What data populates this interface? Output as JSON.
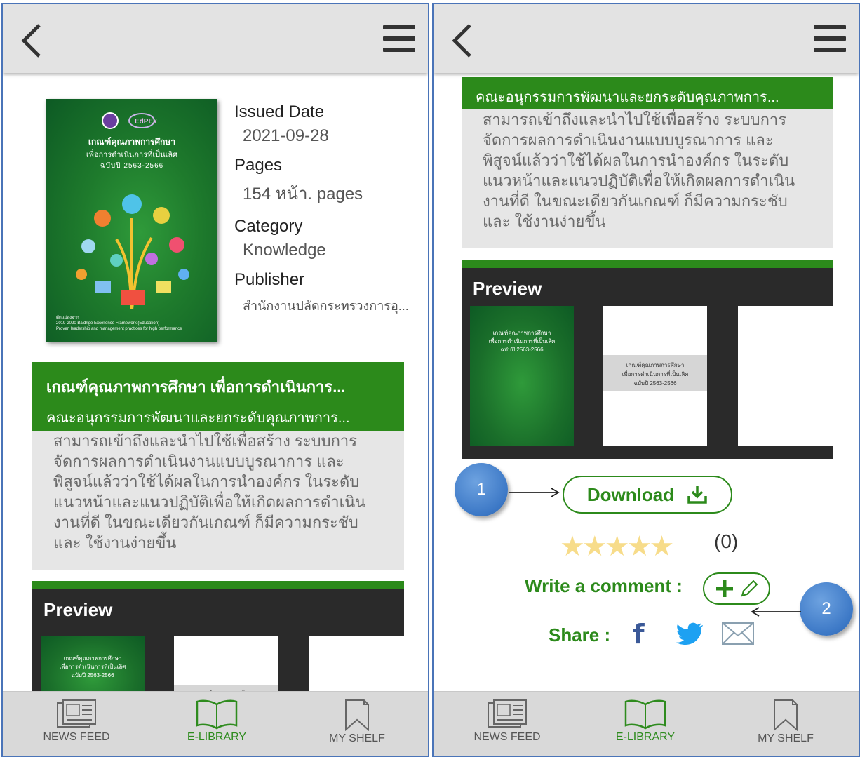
{
  "left": {
    "meta": [
      {
        "label": "Issued Date",
        "value": "2021-09-28"
      },
      {
        "label": "Pages",
        "value": "154 หน้า. pages"
      },
      {
        "label": "Category",
        "value": "Knowledge"
      },
      {
        "label": "Publisher",
        "value": "สำนักงานปลัดกระทรวงการอุ..."
      }
    ],
    "cover": {
      "title": "เกณฑ์คุณภาพการศึกษา",
      "subtitle": "เพื่อการดำเนินการที่เป็นเลิศ",
      "edition": "ฉบับปี 2563-2566",
      "footer1": "ดัดแปลงจาก",
      "footer2": "2019-2020 Baldrige Excellence Framework (Education)",
      "footer3": "Proven leadership and management practices for high performance"
    },
    "book_title": "เกณฑ์คุณภาพการศึกษา เพื่อการดำเนินการ...",
    "book_author": "คณะอนุกรรมการพัฒนาและยกระดับคุณภาพการ...",
    "description": "สามารถเข้าถึงและนำไปใช้เพื่อสร้าง ระบบการจัดการผลการดำเนินงานแบบบูรณาการ และพิสูจน์แล้วว่าใช้ได้ผลในการนำองค์กร ในระดับแนวหน้าและแนวปฏิบัติเพื่อให้เกิดผลการดำเนินงานที่ดี ในขณะเดียวกันเกณฑ์ ก็มีความกระชับและ ใช้งานง่ายขึ้น",
    "preview_title": "Preview"
  },
  "right": {
    "book_author": "คณะอนุกรรมการพัฒนาและยกระดับคุณภาพการ...",
    "description": "สามารถเข้าถึงและนำไปใช้เพื่อสร้าง ระบบการจัดการผลการดำเนินงานแบบบูรณาการ และพิสูจน์แล้วว่าใช้ได้ผลในการนำองค์กร ในระดับแนวหน้าและแนวปฏิบัติเพื่อให้เกิดผลการดำเนินงานที่ดี ในขณะเดียวกันเกณฑ์ ก็มีความกระชับและ ใช้งานง่ายขึ้น",
    "preview_title": "Preview",
    "download_label": "Download",
    "rating_stars": 5,
    "rating_count": "(0)",
    "comment_label": "Write a comment :",
    "share_label": "Share :"
  },
  "preview_page": {
    "title": "เกณฑ์คุณภาพการศึกษา",
    "subtitle": "เพื่อการดำเนินการที่เป็นเลิศ",
    "edition": "ฉบับปี 2563-2566"
  },
  "nav": {
    "news_feed": "NEWS FEED",
    "e_library": "E-LIBRARY",
    "my_shelf": "MY SHELF"
  },
  "callouts": {
    "one": "1",
    "two": "2"
  },
  "colors": {
    "accent_green": "#2c8a1b",
    "callout_blue": "#3c78c6",
    "border_blue": "#4a74b8"
  }
}
